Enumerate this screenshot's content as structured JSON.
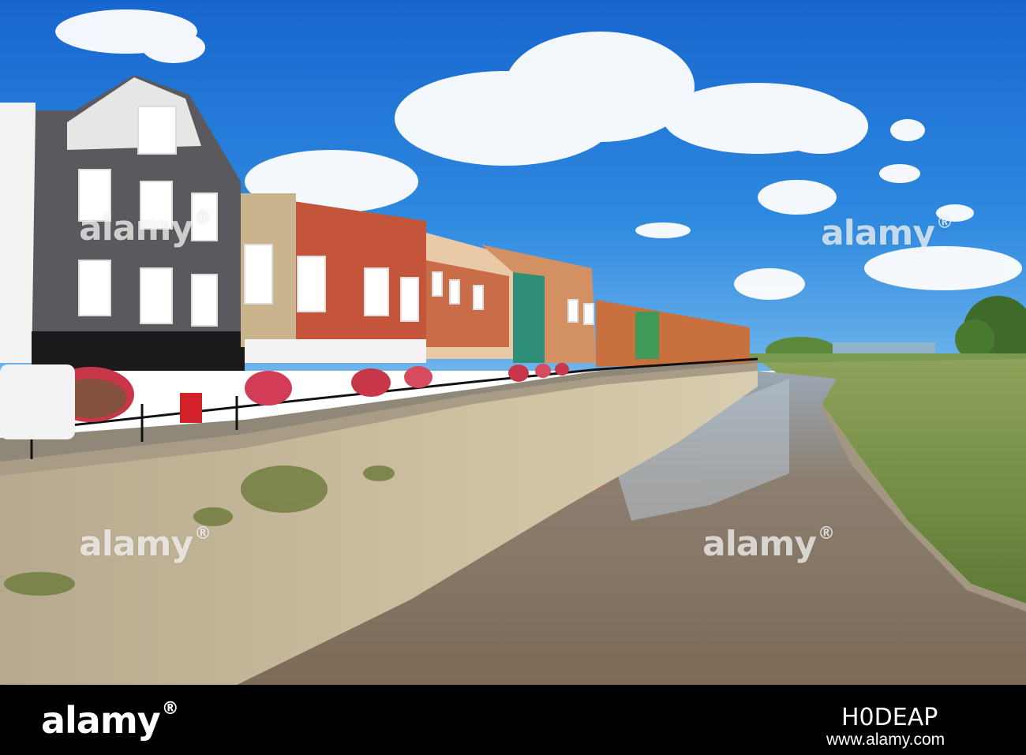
{
  "watermark": {
    "brand": "alamy"
  },
  "footer": {
    "logo_text": "alamy",
    "image_id": "H0DEAP",
    "site_url": "www.alamy.com"
  },
  "colors": {
    "sky": "#1f78d8",
    "river": "#8a7866",
    "quay_wall": "#bfb39a",
    "footer_background": "#000000"
  }
}
